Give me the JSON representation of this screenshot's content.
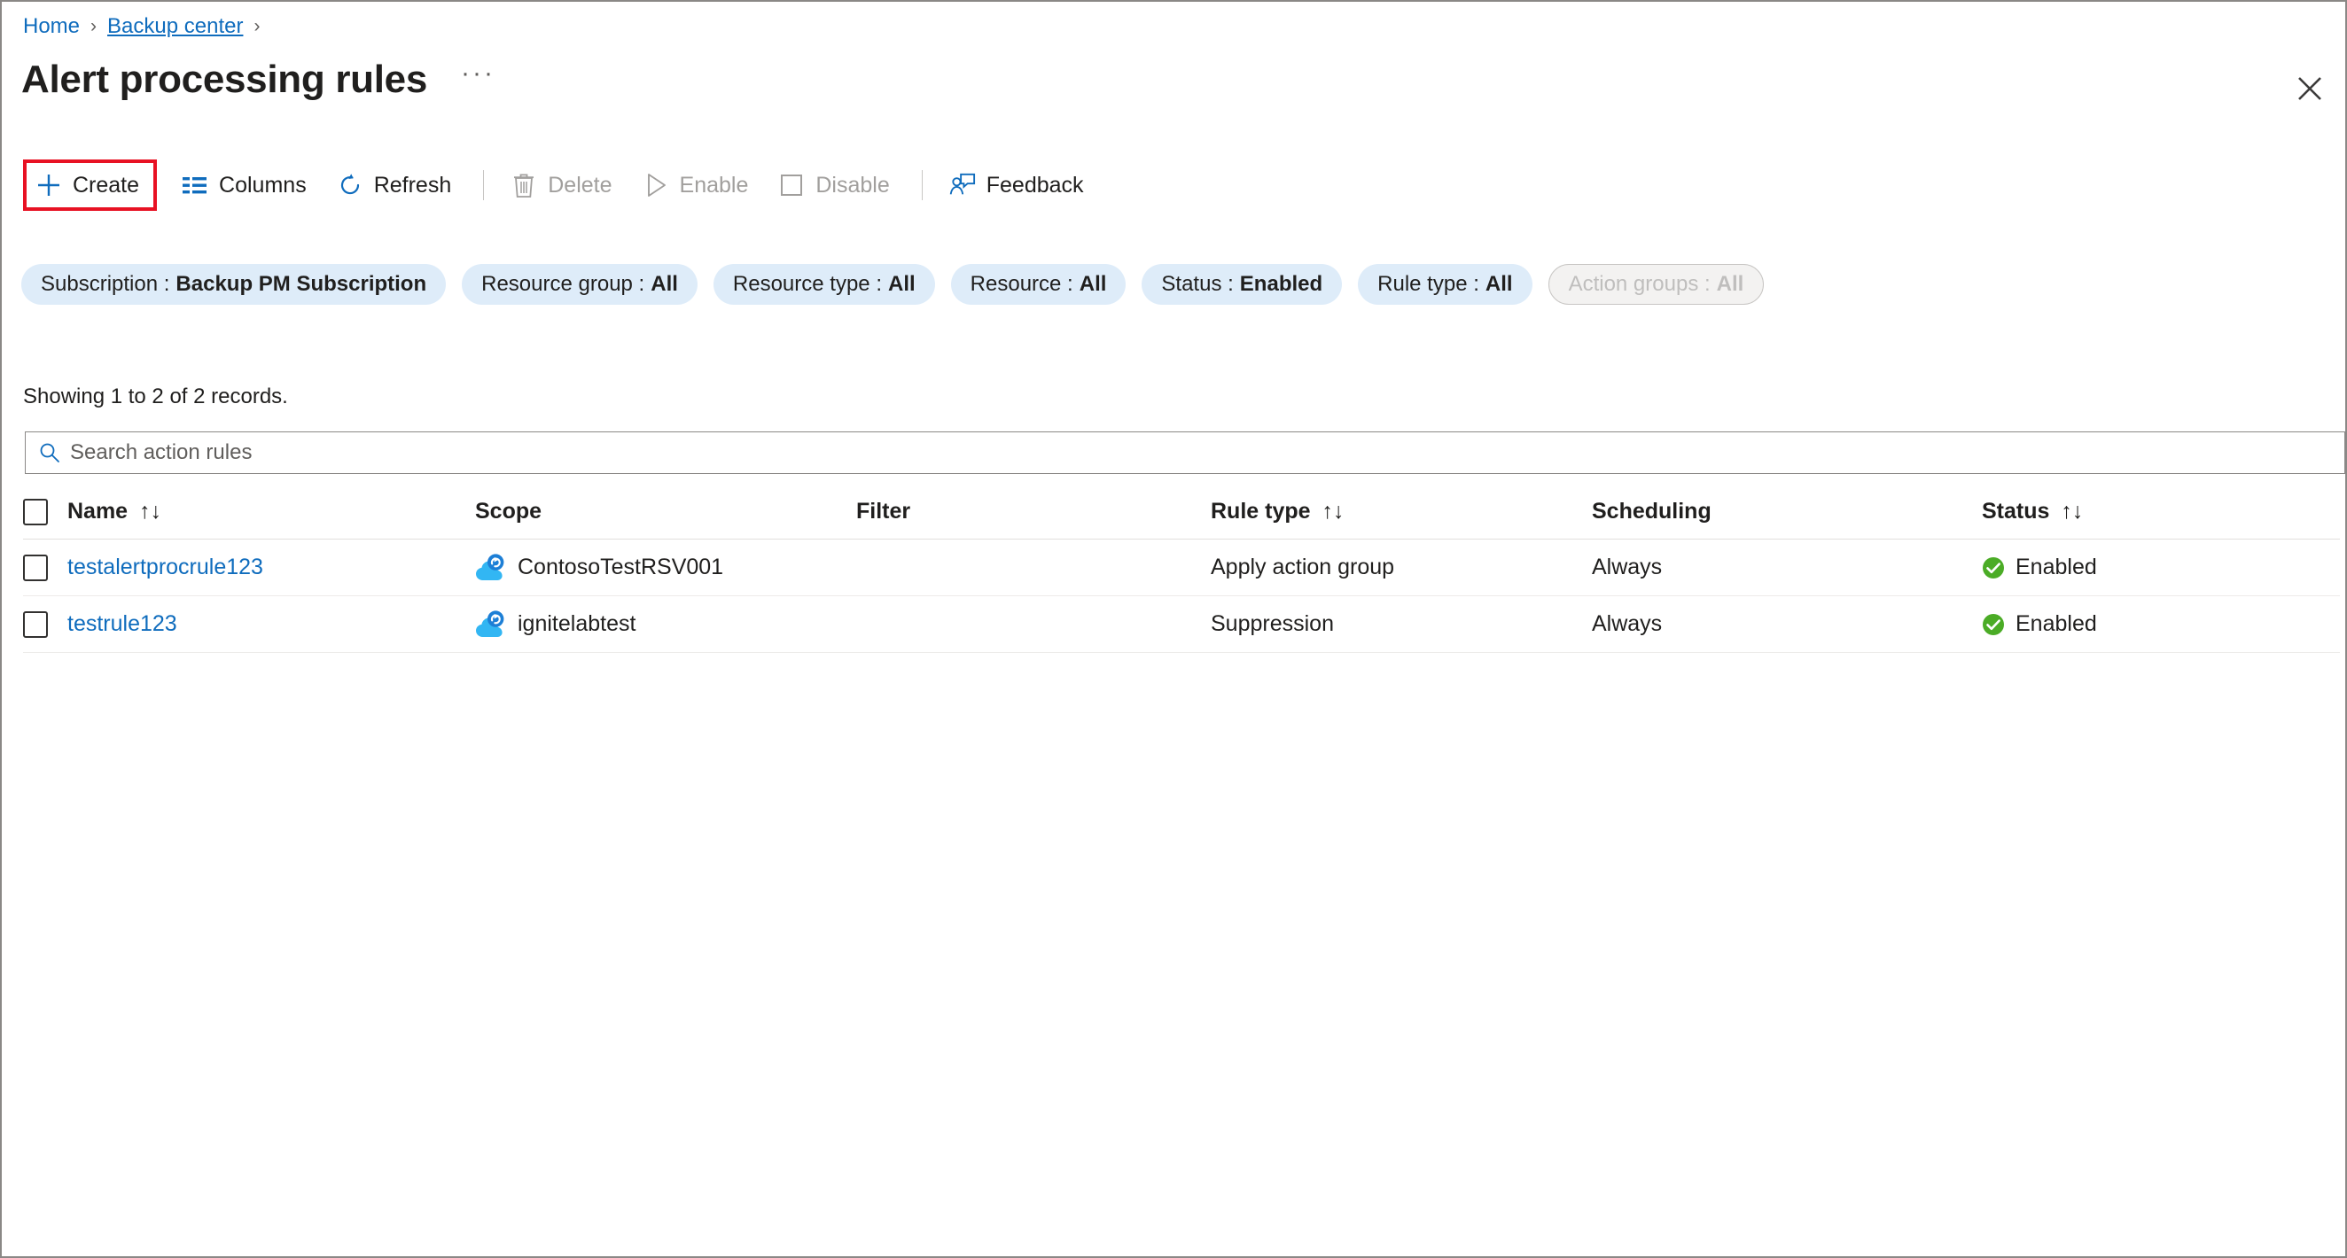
{
  "breadcrumb": {
    "items": [
      {
        "label": "Home",
        "underlined": false
      },
      {
        "label": "Backup center",
        "underlined": true
      }
    ],
    "separator": "›"
  },
  "header": {
    "title": "Alert processing rules",
    "ellipsis": "···",
    "close_icon": "close-icon"
  },
  "toolbar": {
    "items": [
      {
        "label": "Create",
        "icon": "plus-icon",
        "disabled": false,
        "highlighted": true
      },
      {
        "label": "Columns",
        "icon": "columns-icon",
        "disabled": false,
        "highlighted": false
      },
      {
        "label": "Refresh",
        "icon": "refresh-icon",
        "disabled": false,
        "highlighted": false
      },
      {
        "label": "Delete",
        "icon": "trash-icon",
        "disabled": true,
        "highlighted": false
      },
      {
        "label": "Enable",
        "icon": "play-icon",
        "disabled": true,
        "highlighted": false
      },
      {
        "label": "Disable",
        "icon": "square-icon",
        "disabled": true,
        "highlighted": false
      },
      {
        "label": "Feedback",
        "icon": "feedback-icon",
        "disabled": false,
        "highlighted": false
      }
    ],
    "highlight_color": "#e81123"
  },
  "filters": [
    {
      "label": "Subscription",
      "value": "Backup PM Subscription",
      "disabled": false
    },
    {
      "label": "Resource group",
      "value": "All",
      "disabled": false
    },
    {
      "label": "Resource type",
      "value": "All",
      "disabled": false
    },
    {
      "label": "Resource",
      "value": "All",
      "disabled": false
    },
    {
      "label": "Status",
      "value": "Enabled",
      "disabled": false
    },
    {
      "label": "Rule type",
      "value": "All",
      "disabled": false
    },
    {
      "label": "Action groups",
      "value": "All",
      "disabled": true
    }
  ],
  "records_text": "Showing 1 to 2 of 2 records.",
  "search": {
    "placeholder": "Search action rules",
    "value": "",
    "icon": "search-icon"
  },
  "table": {
    "columns": [
      {
        "label": "Name",
        "sortable": true
      },
      {
        "label": "Scope",
        "sortable": false
      },
      {
        "label": "Filter",
        "sortable": false
      },
      {
        "label": "Rule type",
        "sortable": true
      },
      {
        "label": "Scheduling",
        "sortable": false
      },
      {
        "label": "Status",
        "sortable": true
      }
    ],
    "sort_glyph": "↑↓",
    "rows": [
      {
        "name": "testalertprocrule123",
        "scope": "ContosoTestRSV001",
        "scope_icon": "recovery-services-vault-icon",
        "filter": "",
        "rule_type": "Apply action group",
        "scheduling": "Always",
        "status": "Enabled",
        "status_icon": "check-circle-icon"
      },
      {
        "name": "testrule123",
        "scope": "ignitelabtest",
        "scope_icon": "recovery-services-vault-icon",
        "filter": "",
        "rule_type": "Suppression",
        "scheduling": "Always",
        "status": "Enabled",
        "status_icon": "check-circle-icon"
      }
    ]
  },
  "colors": {
    "link": "#0f6cbd",
    "pill_bg": "#deecf9",
    "status_green": "#107c10",
    "highlight_red": "#e81123"
  }
}
